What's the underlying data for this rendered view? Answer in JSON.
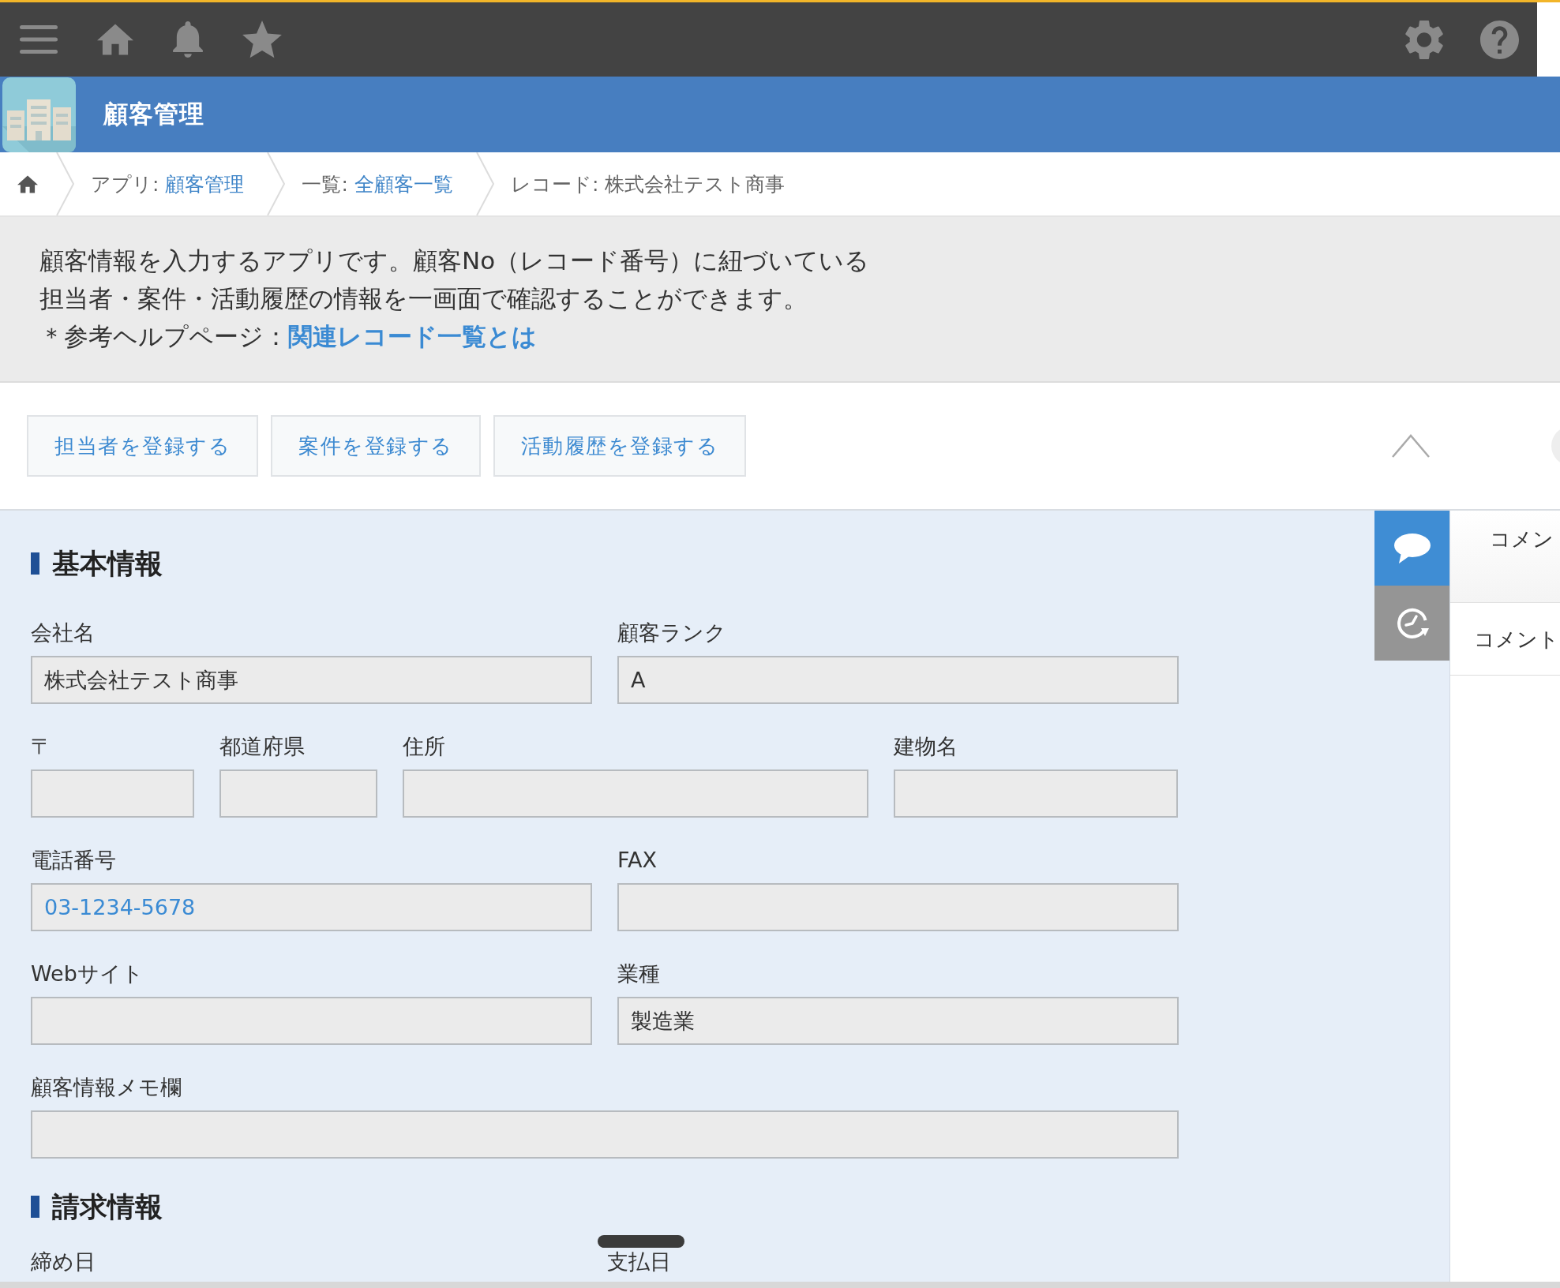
{
  "app_header": {
    "title": "顧客管理"
  },
  "breadcrumb": [
    {
      "kind": "link",
      "label": "アプリ:",
      "link": "顧客管理"
    },
    {
      "kind": "link",
      "label": "一覧:",
      "link": "全顧客一覧"
    },
    {
      "kind": "current",
      "text": "レコード: 株式会社テスト商事"
    }
  ],
  "description": {
    "lines": [
      "顧客情報を入力するアプリです。顧客No（レコード番号）に紐づいている",
      "担当者・案件・活動履歴の情報を一画面で確認することができます。"
    ],
    "help_label": "＊参考ヘルプページ：",
    "help_link": "関連レコード一覧とは"
  },
  "action_buttons": [
    "担当者を登録する",
    "案件を登録する",
    "活動履歴を登録する"
  ],
  "sections": [
    {
      "title": "基本情報",
      "rows": [
        {
          "fields": [
            {
              "label": "会社名",
              "kind": "text",
              "value": "株式会社テスト商事"
            },
            {
              "label": "顧客ランク",
              "kind": "text",
              "value": "A"
            }
          ]
        },
        {
          "fields": [
            {
              "label": "〒",
              "kind": "text"
            },
            {
              "label": "都道府県",
              "kind": "text"
            },
            {
              "label": "住所",
              "kind": "text"
            },
            {
              "label": "建物名",
              "kind": "text"
            }
          ]
        },
        {
          "fields": [
            {
              "label": "電話番号",
              "kind": "link",
              "value": "03-1234-5678"
            },
            {
              "label": "FAX",
              "kind": "text"
            }
          ]
        },
        {
          "fields": [
            {
              "label": "Webサイト",
              "kind": "text"
            },
            {
              "label": "業種",
              "kind": "text",
              "value": "製造業"
            }
          ]
        },
        {
          "fields": [
            {
              "label": "顧客情報メモ欄",
              "kind": "text"
            }
          ]
        }
      ]
    },
    {
      "title": "請求情報",
      "labels": [
        "締め日",
        "支払日"
      ]
    }
  ],
  "side_tabs": [
    {
      "kind": "comment",
      "selected": true
    },
    {
      "kind": "history",
      "selected": false
    }
  ],
  "comment_panel": {
    "title": "コメン",
    "entries": [
      "コメント"
    ]
  }
}
